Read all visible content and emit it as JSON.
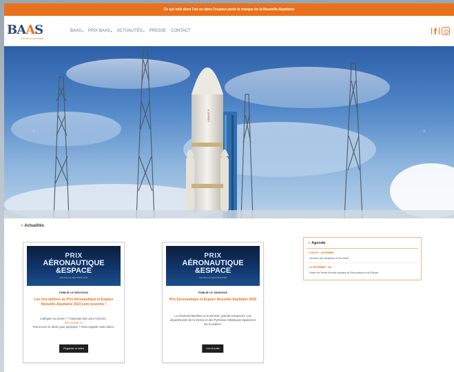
{
  "banner": {
    "text": "Ce qui vole dans l'air ou dans l'espace porte la marque de la Nouvelle-Aquitaine"
  },
  "logo": {
    "text_b": "B",
    "text_a1": "A",
    "text_a2": "A",
    "text_s": "S",
    "subtitle": "NOUVELLE-AQUITAINE"
  },
  "nav": [
    {
      "label": "BAAS",
      "caret": "▾"
    },
    {
      "label": "PRIX BAAS",
      "caret": "▾"
    },
    {
      "label": "ACTUALITÉS",
      "caret": "▾"
    },
    {
      "label": "PRESSE",
      "caret": ""
    },
    {
      "label": "CONTACT",
      "caret": ""
    }
  ],
  "social": {
    "facebook": "f",
    "icons": [
      "facebook-icon",
      "instagram-icon"
    ]
  },
  "hero": {
    "prev": "‹",
    "next": "›",
    "rocket_label": "ARIANE 6"
  },
  "news": {
    "title": "Actualités",
    "cards": [
      {
        "img_l1": "PRIX",
        "img_l2": "AÉRONAUTIQUE",
        "img_l3": "&ESPACE",
        "img_l4": "NOUVELLE-AQUITAINE 2023",
        "date": "PUBLIÉ LE 05/07/2023",
        "title": "Les inscriptions au Prix Aéronautique et Espace Nouvelle-Aquitaine 2023 sont ouvertes !",
        "text1": "Collégien ou lycéen ? T'aimerais bien pour t'inscrire :",
        "link": "ON VAJUS >>",
        "text2": "Pas encore le déclic pour participer ? Alors regarde cette vidéo !",
        "button": "Regarder la vidéo"
      },
      {
        "img_l1": "PRIX",
        "img_l2": "AÉRONAUTIQUE",
        "img_l3": "&ESPACE",
        "img_l4": "NOUVELLE-AQUITAINE 2020",
        "date": "PUBLIÉ LE 19/06/2020",
        "title": "Prix Aéronautique et Espace Nouvelle-Aquitaine 2020",
        "text1": "La Charente-Maritime et la Gironde, grands vainqueurs. Les départements de la Vienne et des Pyrénées-Atlantiques également sur le podium.",
        "link": "",
        "text2": "",
        "button": "Lire la suite"
      }
    ]
  },
  "agenda": {
    "title": "Agenda",
    "items": [
      {
        "date": "» JUILLET – NOVEMBRE",
        "text": "· Ouverture des inscriptions au Prix BAAS"
      },
      {
        "date": "» 13 DÉCEMBRE – 18h",
        "text": "· Soirée des Talents Nouvelle-Aquitaine de l'Aéronautique et de l'Espace"
      }
    ]
  },
  "colors": {
    "accent": "#e9711c",
    "brand_blue": "#2c4c7a"
  }
}
